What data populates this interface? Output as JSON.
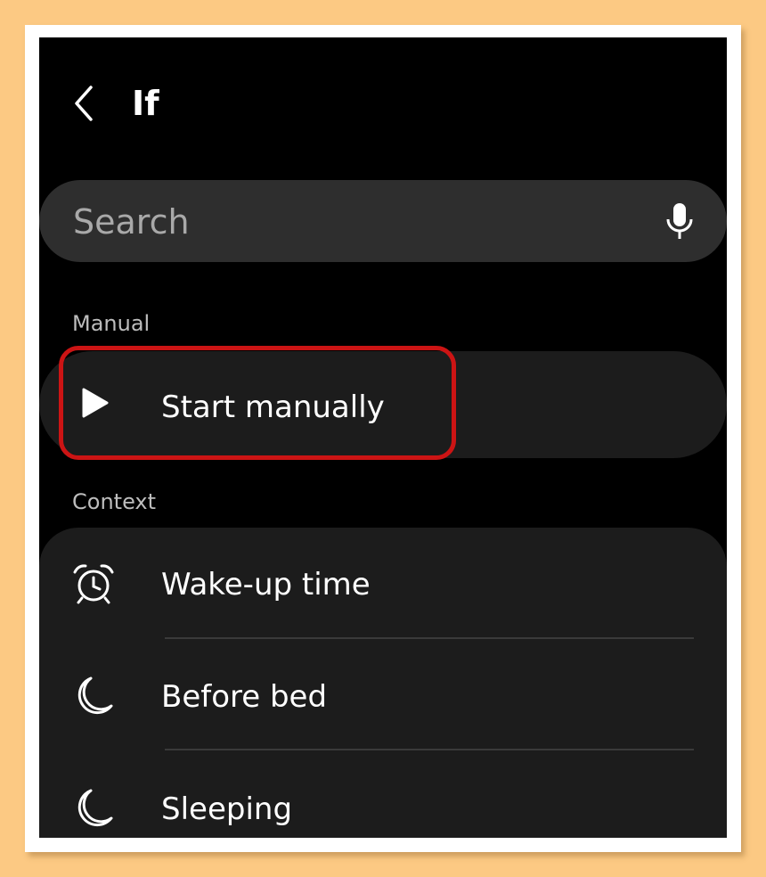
{
  "header": {
    "title": "If",
    "back_icon": "chevron-left-icon"
  },
  "search": {
    "placeholder": "Search",
    "mic_icon": "microphone-icon"
  },
  "sections": {
    "manual": {
      "label": "Manual",
      "items": [
        {
          "label": "Start manually",
          "icon": "play-icon",
          "highlighted": true
        }
      ]
    },
    "context": {
      "label": "Context",
      "items": [
        {
          "label": "Wake-up time",
          "icon": "alarm-clock-icon"
        },
        {
          "label": "Before bed",
          "icon": "moon-icon"
        },
        {
          "label": "Sleeping",
          "icon": "moon-icon"
        }
      ]
    }
  },
  "colors": {
    "background": "#000000",
    "card": "#1c1c1c",
    "search_bg": "#2e2e2e",
    "highlight": "#cc1414",
    "frame": "#fcc983"
  }
}
